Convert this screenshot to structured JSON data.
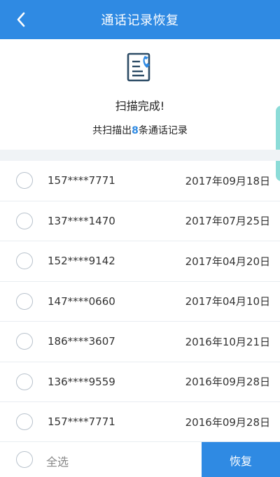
{
  "header": {
    "title": "通话记录恢复",
    "back_icon": "chevron-left-icon"
  },
  "summary": {
    "icon": "document-phone-icon",
    "title": "扫描完成!",
    "count_prefix": "共扫描出",
    "count": "8",
    "count_suffix": "条通话记录"
  },
  "records": [
    {
      "phone": "157****7771",
      "date": "2017年09月18日"
    },
    {
      "phone": "137****1470",
      "date": "2017年07月25日"
    },
    {
      "phone": "152****9142",
      "date": "2017年04月20日"
    },
    {
      "phone": "147****0660",
      "date": "2017年04月10日"
    },
    {
      "phone": "186****3607",
      "date": "2016年10月21日"
    },
    {
      "phone": "136****9559",
      "date": "2016年09月28日"
    },
    {
      "phone": "157****7771",
      "date": "2016年09月28日"
    }
  ],
  "footer": {
    "select_all": "全选",
    "restore": "恢复"
  },
  "colors": {
    "accent": "#2f8ae3",
    "side_tab": "#7fd8d4"
  }
}
